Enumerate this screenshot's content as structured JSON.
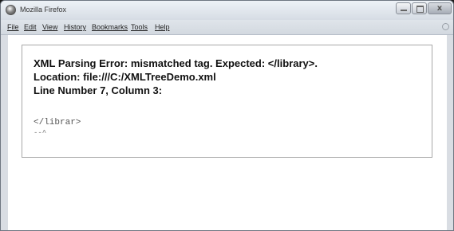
{
  "window": {
    "title": "Mozilla Firefox",
    "close_glyph": "x"
  },
  "menubar": {
    "items": [
      {
        "label": "File"
      },
      {
        "label": "Edit"
      },
      {
        "label": "View"
      },
      {
        "label": "History"
      },
      {
        "label": "Bookmarks"
      },
      {
        "label": "Tools"
      },
      {
        "label": "Help"
      }
    ]
  },
  "error": {
    "line1": "XML Parsing Error: mismatched tag. Expected: </library>.",
    "line2": "Location: file:///C:/XMLTreeDemo.xml",
    "line3": "Line Number 7, Column 3:",
    "source": "</librar>",
    "caret": "--^"
  },
  "icons": [
    "firefox-app-icon",
    "minimize-icon",
    "maximize-icon",
    "close-icon",
    "throbber-icon"
  ]
}
